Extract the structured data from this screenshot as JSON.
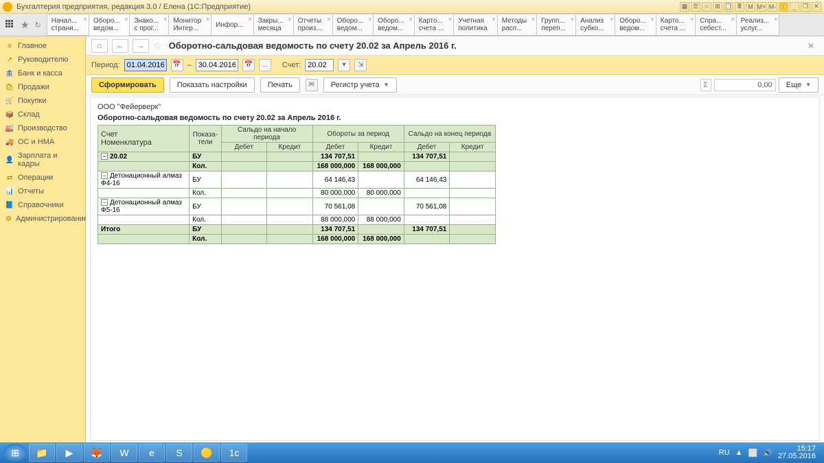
{
  "window": {
    "title": "Бухгалтерия предприятия, редакция 3.0 / Елена  (1С:Предприятие)"
  },
  "tabs": [
    {
      "l1": "Начал...",
      "l2": "страни..."
    },
    {
      "l1": "Оборо...",
      "l2": "ведом..."
    },
    {
      "l1": "Знако...",
      "l2": "с прог..."
    },
    {
      "l1": "Монитор",
      "l2": "Интер..."
    },
    {
      "l1": "Инфор...",
      "l2": ""
    },
    {
      "l1": "Закры...",
      "l2": "месяца"
    },
    {
      "l1": "Отчеты",
      "l2": "произ..."
    },
    {
      "l1": "Оборо...",
      "l2": "ведом..."
    },
    {
      "l1": "Оборо...",
      "l2": "ведом..."
    },
    {
      "l1": "Карто...",
      "l2": "счета ..."
    },
    {
      "l1": "Учетная",
      "l2": "политика"
    },
    {
      "l1": "Методы",
      "l2": "расп..."
    },
    {
      "l1": "Групп...",
      "l2": "переп..."
    },
    {
      "l1": "Анализ",
      "l2": "субко..."
    },
    {
      "l1": "Оборо...",
      "l2": "ведом..."
    },
    {
      "l1": "Карто...",
      "l2": "счета ..."
    },
    {
      "l1": "Спра...",
      "l2": "себест..."
    },
    {
      "l1": "Реализ...",
      "l2": "услуг..."
    }
  ],
  "sidebar": [
    {
      "icon": "≡",
      "label": "Главное"
    },
    {
      "icon": "↗",
      "label": "Руководителю"
    },
    {
      "icon": "🏦",
      "label": "Банк и касса"
    },
    {
      "icon": "🛍",
      "label": "Продажи"
    },
    {
      "icon": "🛒",
      "label": "Покупки"
    },
    {
      "icon": "📦",
      "label": "Склад"
    },
    {
      "icon": "🏭",
      "label": "Производство"
    },
    {
      "icon": "🚚",
      "label": "ОС и НМА"
    },
    {
      "icon": "👤",
      "label": "Зарплата и кадры"
    },
    {
      "icon": "⇄",
      "label": "Операции"
    },
    {
      "icon": "📊",
      "label": "Отчеты"
    },
    {
      "icon": "📘",
      "label": "Справочники"
    },
    {
      "icon": "⚙",
      "label": "Администрирование"
    }
  ],
  "heading": "Оборотно-сальдовая ведомость по счету 20.02 за Апрель 2016 г.",
  "period": {
    "label": "Период:",
    "from": "01.04.2016",
    "to": "30.04.2016",
    "dash": "–"
  },
  "account": {
    "label": "Счет:",
    "value": "20.02"
  },
  "buttons": {
    "form": "Сформировать",
    "settings": "Показать настройки",
    "print": "Печать",
    "register": "Регистр учета",
    "more": "Еще"
  },
  "sum": "0,00",
  "report": {
    "org": "ООО \"Фейерверк\"",
    "title": "Оборотно-сальдовая ведомость по счету 20.02 за Апрель 2016 г.",
    "headers": {
      "acct": "Счет",
      "nomen": "Номенклатура",
      "pokaz": "Показа-\nтели",
      "saldo_start": "Сальдо на начало периода",
      "turnover": "Обороты за период",
      "saldo_end": "Сальдо на конец периода",
      "debit": "Дебет",
      "credit": "Кредит"
    },
    "rows": [
      {
        "a": "20.02",
        "p": "БУ",
        "td": "134 707,51",
        "sed": "134 707,51",
        "tree": true,
        "cls": "acct"
      },
      {
        "a": "",
        "p": "Кол.",
        "td": "168 000,000",
        "tc": "168 000,000",
        "cls": "acct"
      },
      {
        "a": "Детонационный алмаз Ф4-16",
        "p": "БУ",
        "td": "64 146,43",
        "sed": "64 146,43",
        "tree": true
      },
      {
        "a": "",
        "p": "Кол.",
        "td": "80 000,000",
        "tc": "80 000,000"
      },
      {
        "a": "Детонационный алмаз Ф5-16",
        "p": "БУ",
        "td": "70 561,08",
        "sed": "70 561,08",
        "tree": true
      },
      {
        "a": "",
        "p": "Кол.",
        "td": "88 000,000",
        "tc": "88 000,000"
      }
    ],
    "totals": [
      {
        "a": "Итого",
        "p": "БУ",
        "td": "134 707,51",
        "sed": "134 707,51"
      },
      {
        "a": "",
        "p": "Кол.",
        "td": "168 000,000",
        "tc": "168 000,000"
      }
    ]
  },
  "tray": {
    "lang": "RU",
    "time": "15:17",
    "date": "27.05.2016"
  }
}
